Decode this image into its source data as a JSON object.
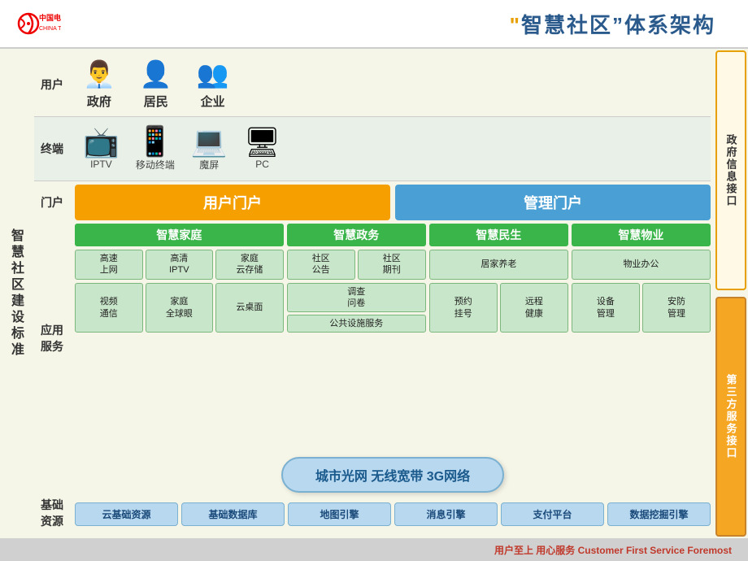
{
  "header": {
    "title_prefix_quote": "“",
    "title_main": "智慧社区”体系架构",
    "company": "中国电信"
  },
  "left_label": "智慧社区建设标准",
  "right_labels": [
    {
      "text": "政府信息接口",
      "style": "normal"
    },
    {
      "text": "第三方服务接口",
      "style": "orange"
    }
  ],
  "users_row": {
    "label": "用户",
    "items": [
      {
        "icon": "👤",
        "label": "政府"
      },
      {
        "icon": "👤",
        "label": "居民"
      },
      {
        "icon": "👤",
        "label": "企业"
      }
    ]
  },
  "terminal_row": {
    "label": "终端",
    "items": [
      {
        "icon": "📺",
        "label": "IPTV"
      },
      {
        "icon": "📱",
        "label": "移动终端"
      },
      {
        "icon": "💻",
        "label": "魔屏"
      },
      {
        "icon": "🖥",
        "label": "PC"
      }
    ]
  },
  "portal_row": {
    "label": "门户",
    "items": [
      {
        "text": "用户门户",
        "color": "orange"
      },
      {
        "text": "管理门户",
        "color": "blue"
      }
    ]
  },
  "app_services": {
    "label": "应用\n服务",
    "categories": [
      {
        "text": "智慧家庭"
      },
      {
        "text": "智慧政务"
      },
      {
        "text": "智慧民生"
      },
      {
        "text": "智慧物业"
      }
    ],
    "zhijia_items": [
      "高速\n上网",
      "高清\nIPTV",
      "家庭\n云存储",
      "视频\n通信",
      "家庭\n全球眼",
      "云桌面"
    ],
    "zhizheng_items": [
      "社区\n公告",
      "社区\n期刊",
      "调查\n问卷",
      "公共设施服务"
    ],
    "zhimin_items": [
      "居家养老",
      "预约\n挂号",
      "远程\n健康"
    ],
    "zhiwu_items": [
      "物业办公",
      "设备\n管理",
      "安防\n管理"
    ]
  },
  "network": {
    "label": "城市光网 无线宽带 3G网络"
  },
  "resources": {
    "label": "基础\n资源",
    "items": [
      "云基础资源",
      "基础数据库",
      "地图引擎",
      "消息引擎",
      "支付平台",
      "数据挖掘引擎"
    ]
  },
  "footer": {
    "text": "用户至上 用心服务 Customer First Service Foremost"
  }
}
